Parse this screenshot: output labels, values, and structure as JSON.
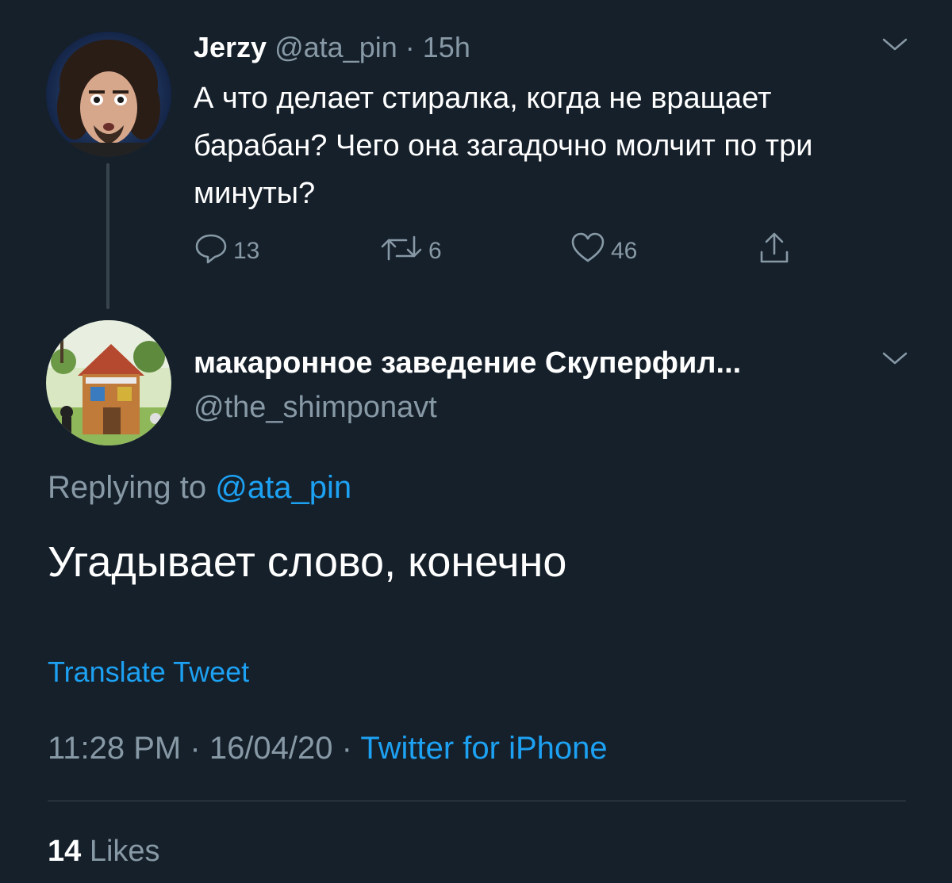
{
  "parent_tweet": {
    "author_name": "Jerzy",
    "author_handle": "@ata_pin",
    "separator": "·",
    "time_ago": "15h",
    "text": "А что делает стиралка, когда не вращает барабан? Чего она загадочно молчит по три минуты?",
    "reply_count": "13",
    "retweet_count": "6",
    "like_count": "46",
    "icons": {
      "reply": "reply-icon",
      "retweet": "retweet-icon",
      "like": "heart-icon",
      "share": "share-icon",
      "menu": "chevron-down-icon"
    }
  },
  "reply_tweet": {
    "author_name": "макаронное заведение Скуперфил...",
    "author_handle": "@the_shimponavt",
    "replying_prefix": "Replying to",
    "replying_to": "@ata_pin",
    "text": "Угадывает слово, конечно",
    "translate_label": "Translate Tweet",
    "time": "11:28 PM",
    "date": "16/04/20",
    "separator": "·",
    "source": "Twitter for iPhone",
    "likes_count": "14",
    "likes_label": "Likes"
  },
  "colors": {
    "background": "#15202b",
    "text_primary": "#ffffff",
    "text_secondary": "#8899a6",
    "accent": "#1da1f2",
    "divider": "#38444d"
  }
}
